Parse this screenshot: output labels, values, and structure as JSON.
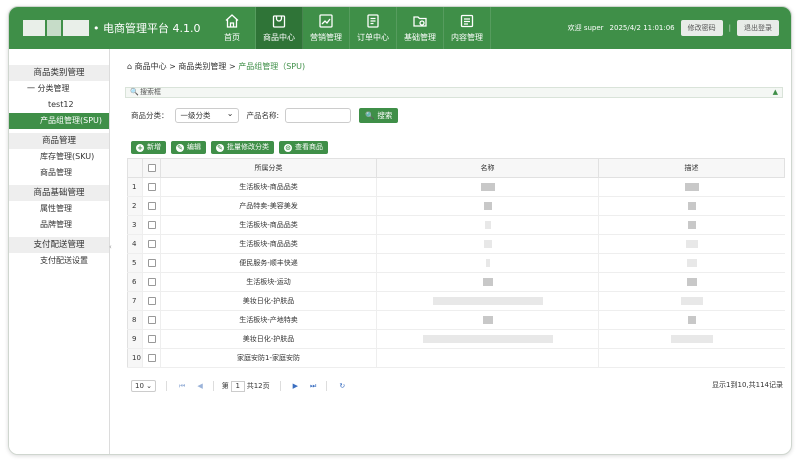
{
  "header": {
    "app_title": "• 电商管理平台 4.1.0",
    "nav": [
      {
        "label": "首页",
        "icon": "home-icon"
      },
      {
        "label": "商品中心",
        "icon": "bag-icon",
        "active": true
      },
      {
        "label": "营销管理",
        "icon": "chart-icon"
      },
      {
        "label": "订单中心",
        "icon": "document-icon"
      },
      {
        "label": "基础管理",
        "icon": "settings-folder-icon"
      },
      {
        "label": "内容管理",
        "icon": "content-icon"
      }
    ],
    "welcome": "欢迎 super",
    "datetime": "2025/4/2 11:01:06",
    "change_password": "修改密码",
    "logout": "退出登录"
  },
  "sidebar": {
    "groups": [
      {
        "title": "商品类别管理",
        "items": [
          {
            "label": "一  分类管理",
            "level": 1
          },
          {
            "label": "test12",
            "level": 3
          },
          {
            "label": "产品组管理(SPU)",
            "level": 2,
            "active": true
          }
        ]
      },
      {
        "title": "商品管理",
        "items": [
          {
            "label": "库存管理(SKU)",
            "level": 2
          },
          {
            "label": "商品管理",
            "level": 2
          }
        ]
      },
      {
        "title": "商品基础管理",
        "items": [
          {
            "label": "属性管理",
            "level": 2
          },
          {
            "label": "品牌管理",
            "level": 2
          }
        ]
      },
      {
        "title": "支付配送管理",
        "items": [
          {
            "label": "支付配送设置",
            "level": 2
          }
        ]
      }
    ]
  },
  "breadcrumb": {
    "path": "商品中心 > 商品类别管理 > ",
    "current": "产品组管理（SPU)"
  },
  "search": {
    "panel_title": "搜索框",
    "category_label": "商品分类：",
    "category_value": "一级分类",
    "name_label": "产品名称:",
    "name_value": "",
    "search_button": "搜索"
  },
  "toolbar": {
    "add": "新增",
    "edit": "编辑",
    "batch": "批量修改分类",
    "view": "查看商品"
  },
  "table": {
    "headers": [
      "所属分类",
      "名称",
      "描述"
    ],
    "rows": [
      {
        "no": "1",
        "category": "生活板块-商品品类"
      },
      {
        "no": "2",
        "category": "产品特卖-美容美发"
      },
      {
        "no": "3",
        "category": "生活板块-商品品类"
      },
      {
        "no": "4",
        "category": "生活板块-商品品类"
      },
      {
        "no": "5",
        "category": "便民服务-顺丰快递"
      },
      {
        "no": "6",
        "category": "生活板块-运动"
      },
      {
        "no": "7",
        "category": "美妆日化-护肤品"
      },
      {
        "no": "8",
        "category": "生活板块-产地特卖"
      },
      {
        "no": "9",
        "category": "美妆日化-护肤品"
      },
      {
        "no": "10",
        "category": "家庭安防1-家庭安防"
      }
    ]
  },
  "pager": {
    "page_size": "10",
    "page_prefix": "第",
    "page": "1",
    "page_total": "共12页",
    "info": "显示1到10,共114记录"
  },
  "colors": {
    "primary": "#3f8f48",
    "primary_dark": "#2f7437"
  }
}
